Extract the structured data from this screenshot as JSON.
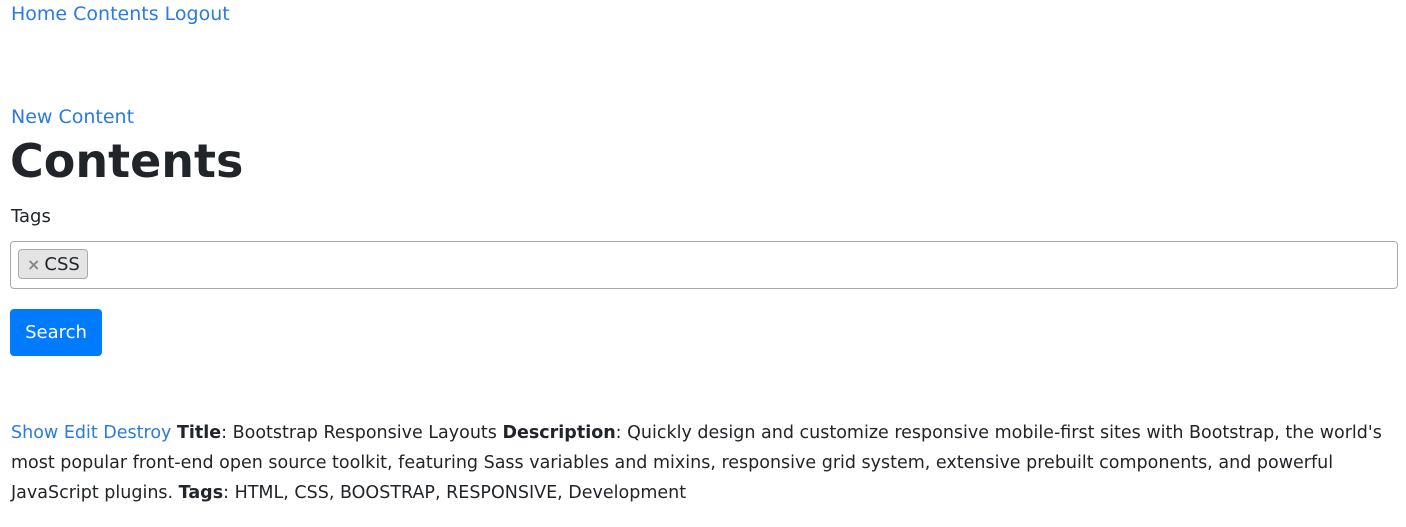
{
  "nav": {
    "home": "Home",
    "contents": "Contents",
    "logout": "Logout"
  },
  "page": {
    "new_content": "New Content",
    "title": "Contents"
  },
  "search_form": {
    "tags_label": "Tags",
    "selected_tags": [
      {
        "remove_symbol": "×",
        "label": "CSS"
      }
    ],
    "submit_label": "Search"
  },
  "records": [
    {
      "actions": {
        "show": "Show",
        "edit": "Edit",
        "destroy": "Destroy"
      },
      "title_label": "Title",
      "title": "Bootstrap Responsive Layouts",
      "description_label": "Description",
      "description": "Quickly design and customize responsive mobile-first sites with Bootstrap, the world's most popular front-end open source toolkit, featuring Sass variables and mixins, responsive grid system, extensive prebuilt components, and powerful JavaScript plugins.",
      "tags_label": "Tags",
      "tags": "HTML, CSS, BOOSTRAP, RESPONSIVE, Development"
    }
  ],
  "colors": {
    "link": "#2a7ae2",
    "primary_button": "#007bff",
    "text": "#212529",
    "chip_background": "#e4e4e4"
  }
}
